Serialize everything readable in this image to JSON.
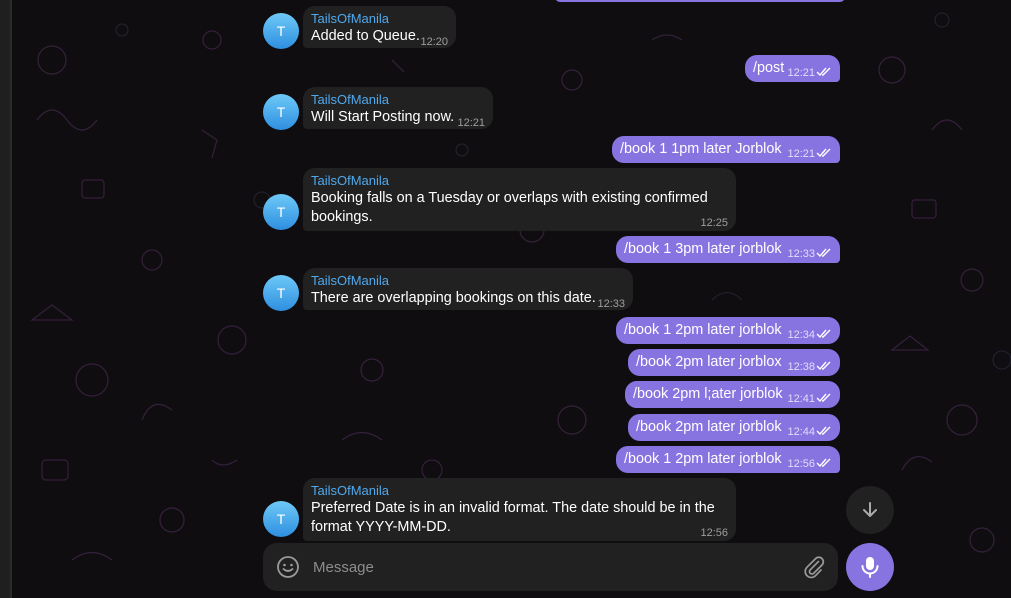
{
  "colors": {
    "incoming": "#212121",
    "outgoing": "#8774e1",
    "sender": "#4fa9ee",
    "background": "#0f0d10"
  },
  "bot": {
    "name": "TailsOfManila",
    "avatar_letter": "T"
  },
  "messages": [
    {
      "dir": "in",
      "sender": "TailsOfManila",
      "text": "Added to Queue.",
      "time": "12:20"
    },
    {
      "dir": "out",
      "text": "/post",
      "time": "12:21"
    },
    {
      "dir": "in",
      "sender": "TailsOfManila",
      "text": "Will Start Posting now.",
      "time": "12:21"
    },
    {
      "dir": "out",
      "text": "/book 1 1pm later Jorblok",
      "time": "12:21"
    },
    {
      "dir": "in",
      "sender": "TailsOfManila",
      "text_line1": "Booking falls on a Tuesday or overlaps with existing confirmed",
      "text_line2": "bookings.",
      "time": "12:25"
    },
    {
      "dir": "out",
      "text": "/book 1 3pm later jorblok",
      "time": "12:33"
    },
    {
      "dir": "in",
      "sender": "TailsOfManila",
      "text": "There are overlapping bookings on this date.",
      "time": "12:33"
    },
    {
      "dir": "out",
      "text": "/book 1 2pm later jorblok",
      "time": "12:34"
    },
    {
      "dir": "out",
      "text": "/book 2pm later jorblox",
      "time": "12:38"
    },
    {
      "dir": "out",
      "text": "/book 2pm l;ater jorblok",
      "time": "12:41"
    },
    {
      "dir": "out",
      "text": "/book 2pm later jorblok",
      "time": "12:44"
    },
    {
      "dir": "out",
      "text": "/book 1 2pm later jorblok",
      "time": "12:56"
    },
    {
      "dir": "in",
      "sender": "TailsOfManila",
      "text_line1": "Preferred Date is in an invalid format. The date should be in the",
      "text_line2": "format YYYY-MM-DD.",
      "time": "12:56"
    }
  ],
  "composer": {
    "placeholder": "Message",
    "emoji_icon": "smile-icon",
    "attach_icon": "paperclip-icon",
    "send_icon": "microphone-icon"
  },
  "scroll": {
    "icon": "arrow-down-icon"
  }
}
